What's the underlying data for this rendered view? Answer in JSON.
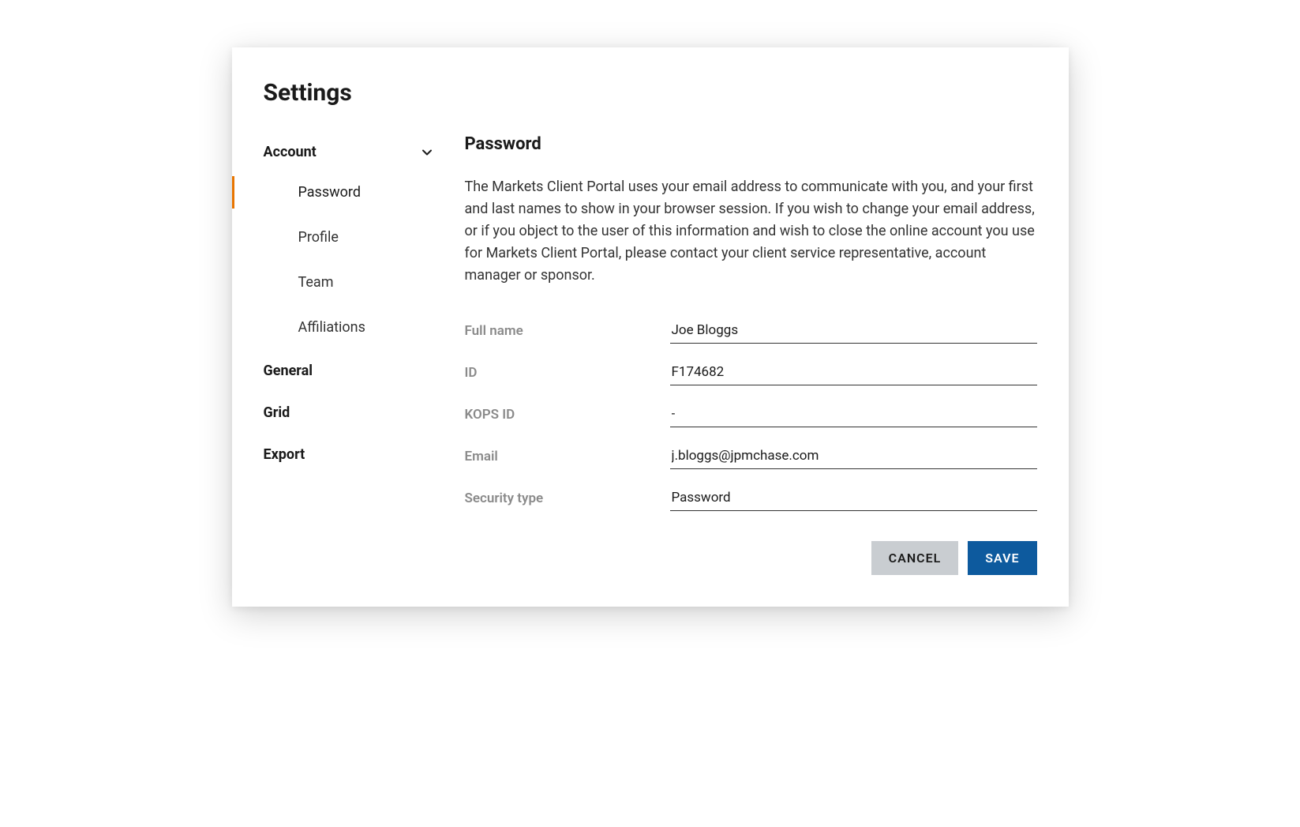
{
  "page": {
    "title": "Settings"
  },
  "sidebar": {
    "groups": [
      {
        "label": "Account",
        "expanded": true,
        "items": [
          {
            "label": "Password",
            "active": true
          },
          {
            "label": "Profile",
            "active": false
          },
          {
            "label": "Team",
            "active": false
          },
          {
            "label": "Affiliations",
            "active": false
          }
        ]
      }
    ],
    "items": [
      {
        "label": "General"
      },
      {
        "label": "Grid"
      },
      {
        "label": "Export"
      }
    ]
  },
  "main": {
    "section_title": "Password",
    "description": "The Markets Client Portal uses your email address to communicate with you, and your first and last names to show in your browser session. If you wish to change your email address, or if you object to the user of this information and wish to close the online account you use for Markets Client Portal, please contact your client service representative, account manager or sponsor.",
    "fields": [
      {
        "label": "Full name",
        "value": "Joe Bloggs"
      },
      {
        "label": "ID",
        "value": "F174682"
      },
      {
        "label": "KOPS ID",
        "value": "-"
      },
      {
        "label": "Email",
        "value": "j.bloggs@jpmchase.com"
      },
      {
        "label": "Security type",
        "value": "Password"
      }
    ]
  },
  "actions": {
    "cancel_label": "CANCEL",
    "save_label": "SAVE"
  }
}
